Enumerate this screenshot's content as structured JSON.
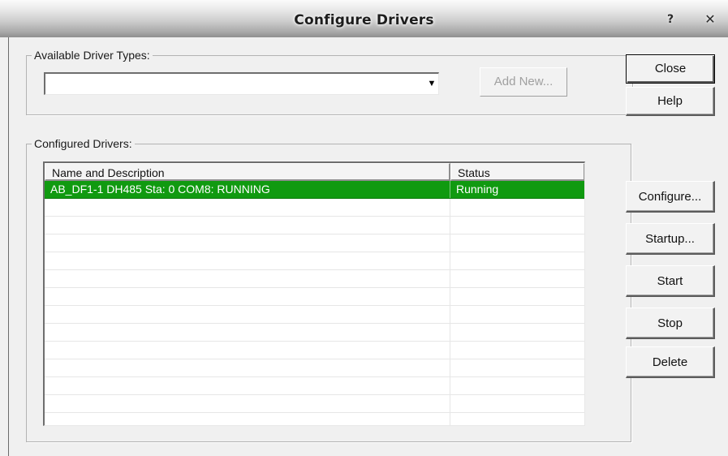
{
  "window": {
    "title": "Configure Drivers",
    "help_glyph": "?",
    "close_glyph": "✕"
  },
  "available": {
    "legend": "Available Driver Types:",
    "combo_value": "",
    "combo_arrow": "▼",
    "add_new_label": "Add New..."
  },
  "configured": {
    "legend": "Configured Drivers:",
    "columns": [
      "Name and Description",
      "Status"
    ],
    "rows": [
      {
        "name": "AB_DF1-1 DH485 Sta: 0 COM8: RUNNING",
        "status": "Running",
        "selected": true
      },
      {
        "name": "",
        "status": ""
      },
      {
        "name": "",
        "status": ""
      },
      {
        "name": "",
        "status": ""
      },
      {
        "name": "",
        "status": ""
      },
      {
        "name": "",
        "status": ""
      },
      {
        "name": "",
        "status": ""
      },
      {
        "name": "",
        "status": ""
      },
      {
        "name": "",
        "status": ""
      },
      {
        "name": "",
        "status": ""
      },
      {
        "name": "",
        "status": ""
      },
      {
        "name": "",
        "status": ""
      },
      {
        "name": "",
        "status": ""
      },
      {
        "name": "",
        "status": ""
      }
    ]
  },
  "buttons": {
    "close": "Close",
    "help": "Help",
    "configure": "Configure...",
    "startup": "Startup...",
    "start": "Start",
    "stop": "Stop",
    "delete": "Delete"
  },
  "colors": {
    "selection": "#109a10",
    "selection_text": "#ffffff"
  }
}
